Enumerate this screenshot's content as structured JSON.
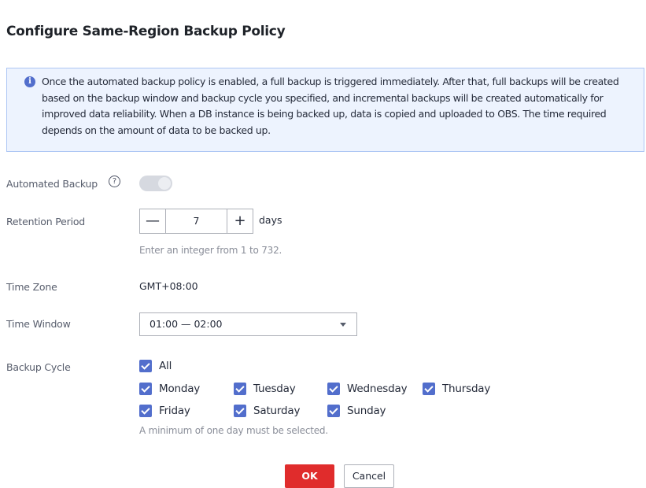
{
  "dialog": {
    "title": "Configure Same-Region Backup Policy"
  },
  "notice": {
    "icon": "info-icon",
    "text": "Once the automated backup policy is enabled, a full backup is triggered immediately. After that, full backups will be created based on the backup window and backup cycle you specified, and incremental backups will be created automatically for improved data reliability. When a DB instance is being backed up, data is copied and uploaded to OBS. The time required depends on the amount of data to be backed up."
  },
  "form": {
    "automated_backup": {
      "label": "Automated Backup",
      "help_icon": "question-icon",
      "help_glyph": "?",
      "enabled": true
    },
    "retention_period": {
      "label": "Retention Period",
      "minus": "—",
      "value": "7",
      "plus": "+",
      "unit": "days",
      "hint": "Enter an integer from 1 to 732."
    },
    "time_zone": {
      "label": "Time Zone",
      "value": "GMT+08:00"
    },
    "time_window": {
      "label": "Time Window",
      "value": "01:00 — 02:00"
    },
    "backup_cycle": {
      "label": "Backup Cycle",
      "all": "All",
      "days": [
        "Monday",
        "Tuesday",
        "Wednesday",
        "Thursday",
        "Friday",
        "Saturday",
        "Sunday"
      ],
      "hint": "A minimum of one day must be selected."
    }
  },
  "actions": {
    "ok": "OK",
    "cancel": "Cancel"
  },
  "colors": {
    "accent": "#526ecc",
    "primary_button": "#e02c2c",
    "notice_bg": "#edf3fe"
  }
}
